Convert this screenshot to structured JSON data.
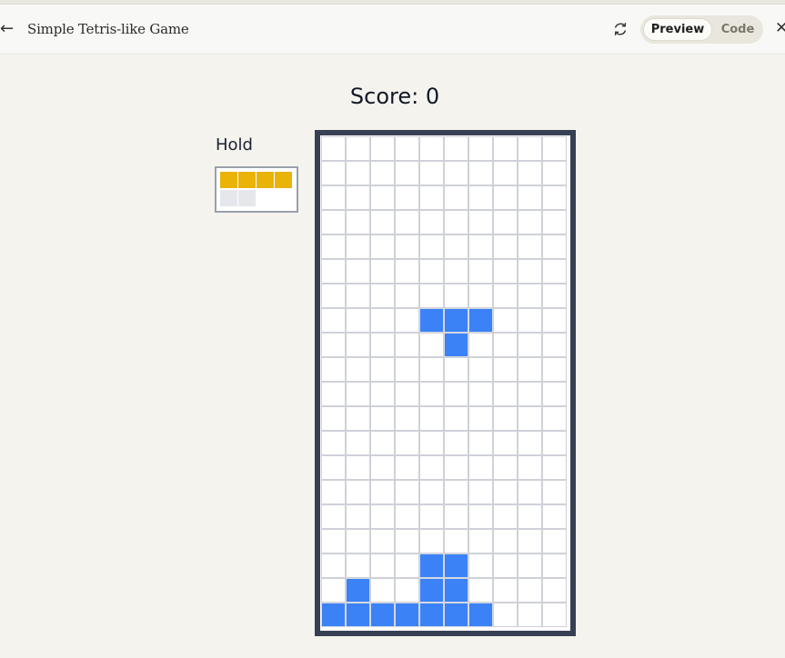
{
  "header": {
    "back_icon": "arrow-left-icon",
    "title": "Simple Tetris-like Game",
    "refresh_icon": "refresh-icon",
    "toggle": {
      "preview_label": "Preview",
      "code_label": "Code",
      "selected": "Preview"
    },
    "close_icon": "close-icon"
  },
  "game": {
    "score_text": "Score: 0",
    "hold_label": "Hold",
    "hold_piece": {
      "color": "#eab308",
      "empty_color": "#e5e7eb",
      "grid": [
        [
          1,
          1,
          1,
          1
        ],
        [
          0,
          0,
          0,
          0
        ]
      ],
      "columns": 4,
      "rows": 2
    },
    "board": {
      "columns": 10,
      "rows": 20,
      "piece_color": "#3b82f6",
      "cells": [
        "..........",
        "..........",
        "..........",
        "..........",
        "..........",
        "..........",
        "..........",
        "....XXX...",
        ".....X....",
        "..........",
        "..........",
        "..........",
        "..........",
        "..........",
        "..........",
        "..........",
        "..........",
        "....XX....",
        ".X..XX....",
        "XXXXXXX..."
      ]
    }
  }
}
